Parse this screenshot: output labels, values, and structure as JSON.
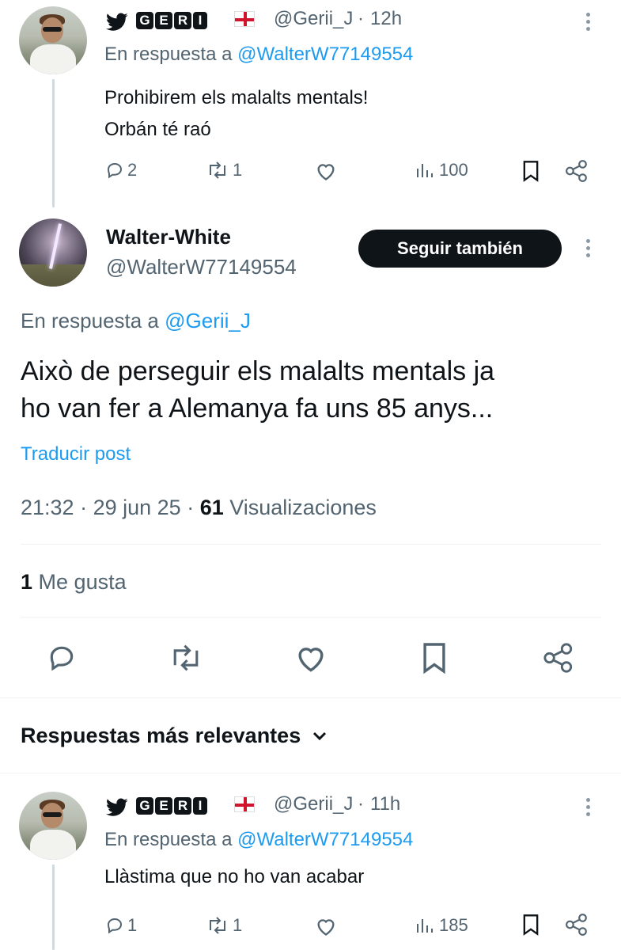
{
  "reply1": {
    "badge": "GERI",
    "handle": "@Gerii_J",
    "time": "12h",
    "in_reply_label": "En respuesta a",
    "in_reply_target": "@WalterW77149554",
    "text_line1": "Prohibirem els malalts mentals!",
    "text_line2": "Orbán té raó",
    "replies": "2",
    "reposts": "1",
    "views": "100"
  },
  "main_tweet": {
    "display_name": "Walter-White",
    "handle": "@WalterW77149554",
    "follow_label": "Seguir también",
    "in_reply_label": "En respuesta a",
    "in_reply_target": "@Gerii_J",
    "text_line1": "Això de perseguir els malalts mentals ja",
    "text_line2": "ho van fer a Alemanya fa uns 85 anys...",
    "translate_label": "Traducir post",
    "time": "21:32",
    "date": "29 jun 25",
    "view_count": "61",
    "view_label": "Visualizaciones",
    "like_count": "1",
    "like_label": "Me gusta"
  },
  "replies_section": {
    "sort_label": "Respuestas más relevantes"
  },
  "reply2": {
    "badge": "GERI",
    "handle": "@Gerii_J",
    "time": "11h",
    "in_reply_label": "En respuesta a",
    "in_reply_target": "@WalterW77149554",
    "text_line1": "Llàstima que no ho van acabar",
    "replies": "1",
    "reposts": "1",
    "views": "185"
  },
  "colors": {
    "text": "#0f1419",
    "muted": "#536471",
    "link": "#1d9bf0",
    "button_bg": "#0f1419"
  }
}
